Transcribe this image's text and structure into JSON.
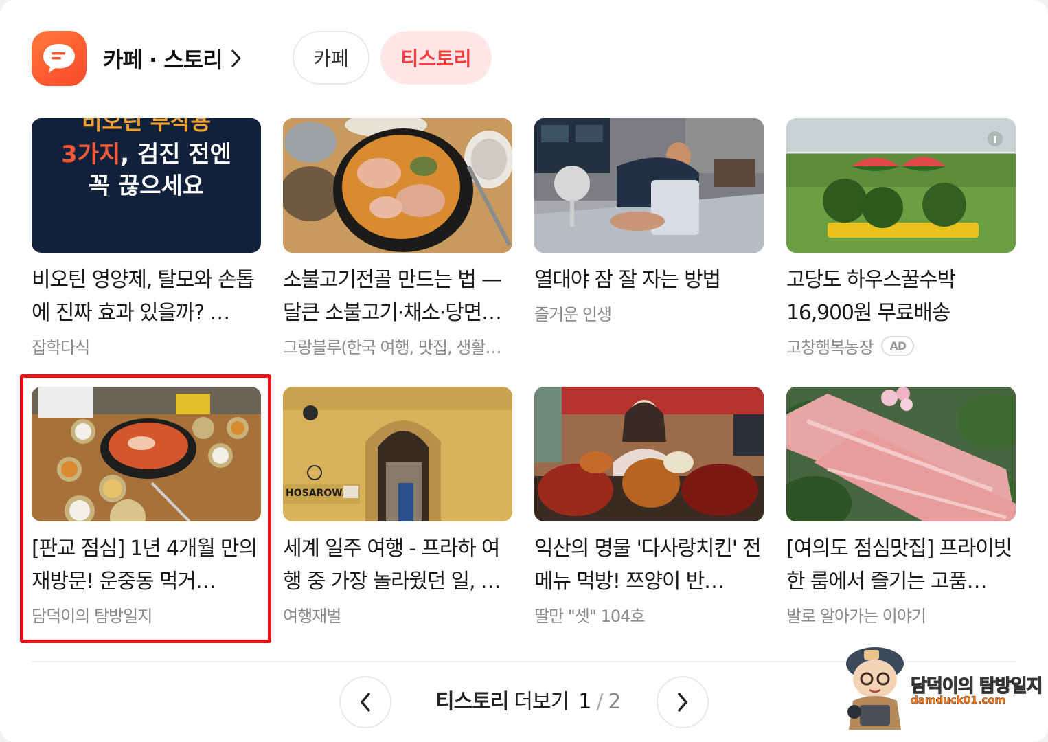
{
  "header": {
    "title": "카페 · 스토리",
    "tabs": [
      {
        "label": "카페",
        "active": false
      },
      {
        "label": "티스토리",
        "active": true
      }
    ]
  },
  "cards": [
    {
      "title": "비오틴 영양제, 탈모와 손톱에 진짜 효과 있을까? …",
      "source": "잡학다식",
      "thumb_text_line1": "비오틴 부작용",
      "thumb_text_line2_accent": "3가지",
      "thumb_text_line2_rest": ", 검진 전엔",
      "thumb_text_line3": "꼭 끊으세요"
    },
    {
      "title": "소불고기전골 만드는 법 — 달큰 소불고기·채소·당면…",
      "source": "그랑블루(한국 여행, 맛집, 생활…"
    },
    {
      "title": "열대야 잠 잘 자는 방법",
      "source": "즐거운 인생"
    },
    {
      "title": "고당도 하우스꿀수박 16,900원 무료배송",
      "source": "고창행복농장",
      "badge": "AD"
    },
    {
      "title": "[판교 점심] 1년 4개월 만의 재방문! 운중동 먹거…",
      "source": "담덕이의 탐방일지"
    },
    {
      "title": "세계 일주 여행 - 프라하 여행 중 가장 놀라웠던 일, …",
      "source": "여행재벌",
      "thumb_sign": "HOSAROWA"
    },
    {
      "title": "익산의 명물 '다사랑치킨' 전메뉴 먹방! 쯔양이 반…",
      "source": "딸만 \"셋\" 104호"
    },
    {
      "title": "[여의도 점심맛집] 프라이빗한 룸에서 즐기는 고품…",
      "source": "발로 알아가는 이야기"
    }
  ],
  "pagination": {
    "brand": "티스토리",
    "label": "더보기",
    "current": "1",
    "separator": "/",
    "total": "2"
  },
  "watermark": {
    "name": "담덕이의 탐방일지",
    "url": "damduck01.com"
  },
  "colors": {
    "accent": "#ff3c3c",
    "highlight_box": "#ee0f18",
    "app_icon": "#ff5a30"
  }
}
